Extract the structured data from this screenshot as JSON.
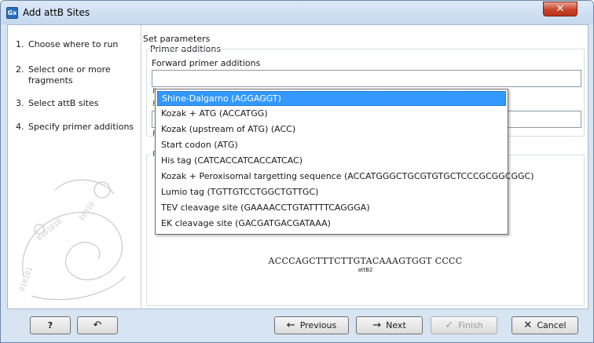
{
  "window": {
    "title": "Add attB Sites",
    "app_icon_text": "Gx",
    "close_glyph": "✕"
  },
  "steps": [
    {
      "num": "1.",
      "label": "Choose where to run"
    },
    {
      "num": "2.",
      "label": "Select one or more fragments"
    },
    {
      "num": "3.",
      "label": "Select attB sites"
    },
    {
      "num": "4.",
      "label": "Specify primer additions"
    }
  ],
  "main": {
    "heading": "Set parameters",
    "group_title": "Primer additions",
    "forward_label": "Forward primer additions",
    "forward_value": "",
    "reverse_value": "",
    "stub_r": "R",
    "stub_f": "F",
    "stub_p": "P",
    "sequence": "ACCCAGCTTTCTTGTACAAAGTGGT CCCC",
    "sequence_label": "attB2"
  },
  "dropdown": {
    "selected_index": 0,
    "options": [
      "Shine-Dalgarno (AGGAGGT)",
      "Kozak + ATG (ACCATGG)",
      "Kozak (upstream of ATG) (ACC)",
      "Start codon (ATG)",
      "His tag (CATCACCATCACCATCAC)",
      "Kozak + Peroxisomal targetting sequence (ACCATGGGCTGCGTGTGCTCCCGCGGCGGC)",
      "Lumio tag (TGTTGTCCTGGCTGTTGC)",
      "TEV cleavage site (GAAAACCTGTATTTTCAGGGA)",
      "EK cleavage site (GACGATGACGATAAA)"
    ]
  },
  "buttons": {
    "help": "?",
    "reset_icon": "↶",
    "previous": "Previous",
    "previous_icon": "←",
    "next": "Next",
    "next_icon": "→",
    "finish": "Finish",
    "finish_icon": "✓",
    "cancel": "Cancel",
    "cancel_icon": "✕"
  },
  "colors": {
    "accent": "#3399ff",
    "frame": "#d7e4f2",
    "close": "#c7432a"
  }
}
